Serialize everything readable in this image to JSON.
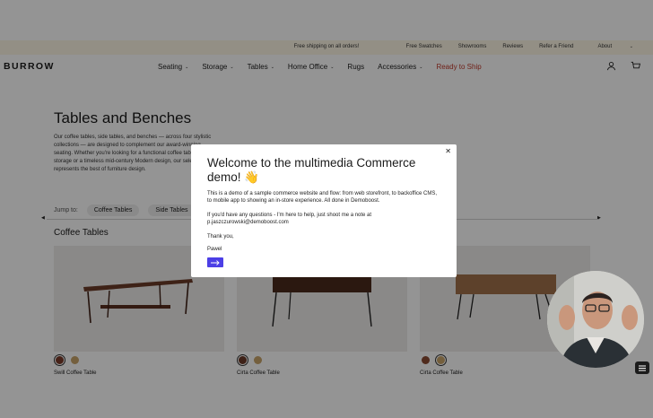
{
  "topbar": {
    "shipping": "Free shipping on all orders!",
    "links": [
      "Free Swatches",
      "Showrooms",
      "Reviews",
      "Refer a Friend",
      "About"
    ]
  },
  "nav": {
    "logo": "BURROW",
    "items": [
      "Seating",
      "Storage",
      "Tables",
      "Home Office",
      "Rugs",
      "Accessories",
      "Ready to Ship"
    ],
    "highlight_color": "#c0392b"
  },
  "page": {
    "title": "Tables and Benches",
    "intro": "Our coffee tables, side tables, and benches — across four stylistic collections — are designed to complement our award-winning seating. Whether you're looking for a functional coffee table for storage or a timeless mid-century Modern design, our selection represents the best of furniture design."
  },
  "jump": {
    "label": "Jump to:",
    "pills": [
      "Coffee Tables",
      "Side Tables"
    ]
  },
  "section": {
    "title": "Coffee Tables"
  },
  "products": [
    {
      "name": "Swill Coffee Table",
      "swatches": [
        "#7a3b2a",
        "#c9a46a"
      ]
    },
    {
      "name": "Cirta Coffee Table",
      "swatches": [
        "#6b3a28",
        "#c9a46a"
      ]
    },
    {
      "name": "Cirta Coffee Table",
      "swatches": [
        "#8a4a32",
        "#c9a46a"
      ]
    }
  ],
  "modal": {
    "title": "Welcome to the multimedia Commerce demo! 👋",
    "p1": "This is a demo of a sample commerce website and flow: from web storefront, to backoffice CMS, to mobile app to showing an in-store experience. All done in Demoboost.",
    "p2": "If you'd have any questions - I'm here to help, just shoot me a note at p.jaszczurowski@demoboost.com",
    "p3": "Thank you,",
    "p4": "Pawel",
    "button_color": "#4c3fe6"
  },
  "icons": {
    "close": "close-icon",
    "user": "user-icon",
    "cart": "cart-icon",
    "arrow": "arrow-right-icon",
    "chat": "menu-icon"
  }
}
